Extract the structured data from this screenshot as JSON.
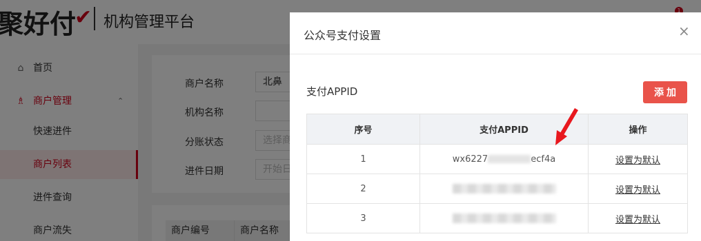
{
  "header": {
    "logo": "聚好付",
    "logo_check": "✔",
    "platform": "机构管理平台",
    "notification_count": "1"
  },
  "sidebar": {
    "items": [
      {
        "label": "首页",
        "icon": "home-icon"
      },
      {
        "label": "商户管理",
        "icon": "merchant-icon",
        "chevron": "⌃"
      },
      {
        "label": "快速进件"
      },
      {
        "label": "商户列表"
      },
      {
        "label": "进件查询"
      },
      {
        "label": "商户流失"
      }
    ]
  },
  "filters": {
    "merchant_name": {
      "label": "商户名称",
      "value": "北鼻"
    },
    "org_name": {
      "label": "机构名称",
      "value": ""
    },
    "split_status": {
      "label": "分账状态",
      "placeholder": "选择商"
    },
    "entry_date": {
      "label": "进件日期",
      "placeholder": "开始日"
    }
  },
  "bg_table": {
    "headers": [
      "商户编号",
      "商户名称"
    ]
  },
  "modal": {
    "title": "公众号支付设置",
    "close": "×",
    "section_title": "支付APPID",
    "add_button": "添加",
    "table": {
      "headers": [
        "序号",
        "支付APPID",
        "操作"
      ],
      "rows": [
        {
          "index": "1",
          "appid_prefix": "wx6227",
          "appid_suffix": "ecf4a",
          "action": "设置为默认"
        },
        {
          "index": "2",
          "action": "设置为默认"
        },
        {
          "index": "3",
          "action": "设置为默认"
        }
      ]
    }
  },
  "colors": {
    "brand_red": "#d0021b",
    "add_button": "#e9534a",
    "arrow": "#e8181e"
  }
}
